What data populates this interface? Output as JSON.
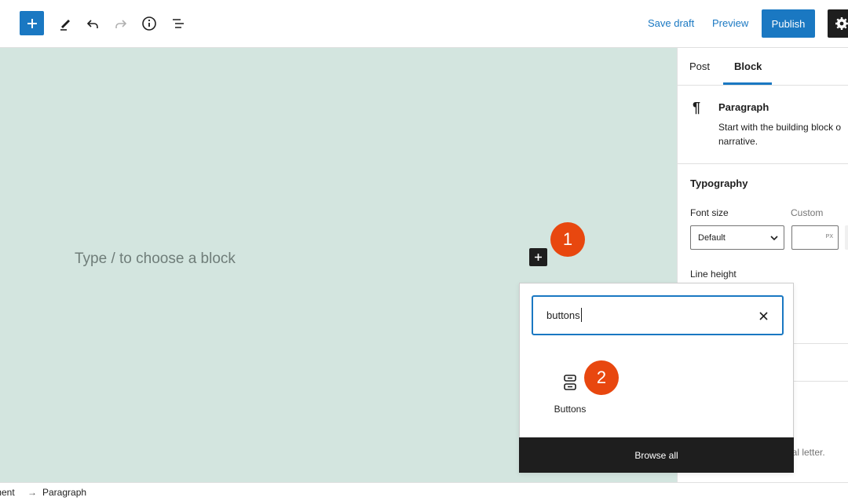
{
  "toolbar": {
    "inserter_icon": "plus-icon",
    "tools": [
      {
        "name": "edit-tool-icon"
      },
      {
        "name": "undo-icon"
      },
      {
        "name": "redo-icon"
      },
      {
        "name": "info-icon"
      },
      {
        "name": "list-view-icon"
      }
    ],
    "save_draft": "Save draft",
    "preview": "Preview",
    "publish": "Publish",
    "settings_icon": "gear-icon",
    "accent": "#1a78c2"
  },
  "canvas": {
    "placeholder": "Type / to choose a block",
    "background": "#d3e5df",
    "markers": [
      "1",
      "2"
    ]
  },
  "sidebar": {
    "tabs": [
      "Post",
      "Block"
    ],
    "active_tab": "Block",
    "block": {
      "icon": "paragraph-icon",
      "title": "Paragraph",
      "desc_line1": "Start with the building block o",
      "desc_line2": "narrative."
    },
    "typography": {
      "title": "Typography",
      "font_size_label": "Font size",
      "custom_label": "Custom",
      "font_size_value": "Default",
      "unit": "PX",
      "line_height_label": "Line height"
    },
    "truncated_text": "itial letter."
  },
  "inserter": {
    "search_value": "buttons",
    "result": {
      "icon": "buttons-block-icon",
      "label": "Buttons"
    },
    "browse_all": "Browse all"
  },
  "breadcrumb": {
    "document": "ment",
    "arrow": "→",
    "current": "Paragraph"
  }
}
